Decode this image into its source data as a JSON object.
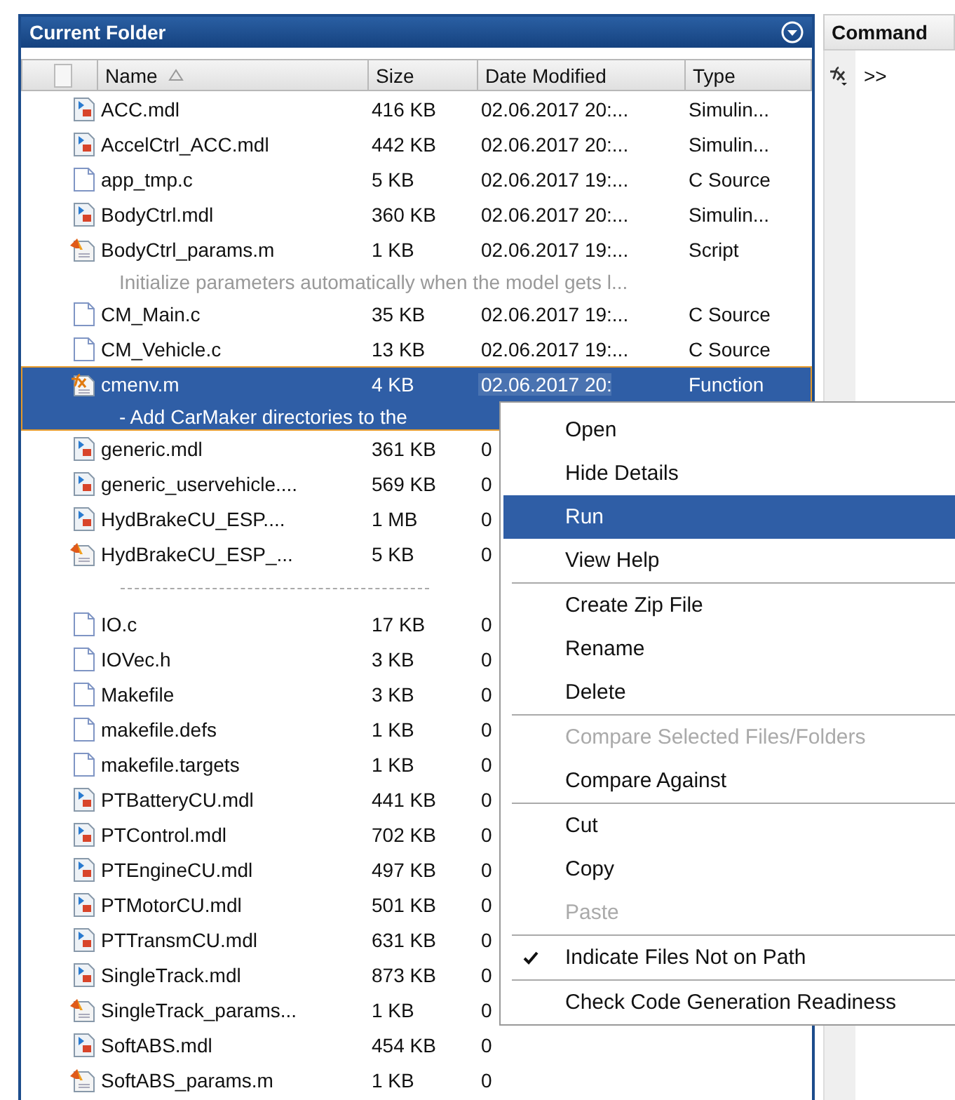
{
  "folder_panel": {
    "title": "Current Folder",
    "columns": [
      {
        "label": "Name",
        "sorted": true
      },
      {
        "label": "Size",
        "sorted": false
      },
      {
        "label": "Date Modified",
        "sorted": false
      },
      {
        "label": "Type",
        "sorted": false
      }
    ],
    "rows": [
      {
        "kind": "model",
        "name": "ACC.mdl",
        "size": "416 KB",
        "date": "02.06.2017 20:...",
        "type": "Simulin...",
        "selected": false
      },
      {
        "kind": "model",
        "name": "AccelCtrl_ACC.mdl",
        "size": "442 KB",
        "date": "02.06.2017 20:...",
        "type": "Simulin...",
        "selected": false
      },
      {
        "kind": "text",
        "name": "app_tmp.c",
        "size": "5 KB",
        "date": "02.06.2017 19:...",
        "type": "C Source",
        "selected": false
      },
      {
        "kind": "model",
        "name": "BodyCtrl.mdl",
        "size": "360 KB",
        "date": "02.06.2017 20:...",
        "type": "Simulin...",
        "selected": false
      },
      {
        "kind": "script",
        "name": "BodyCtrl_params.m",
        "size": "1 KB",
        "date": "02.06.2017 19:...",
        "type": "Script",
        "description": "Initialize parameters automatically when the model gets l...",
        "selected": false
      },
      {
        "kind": "text",
        "name": "CM_Main.c",
        "size": "35 KB",
        "date": "02.06.2017 19:...",
        "type": "C Source",
        "selected": false
      },
      {
        "kind": "text",
        "name": "CM_Vehicle.c",
        "size": "13 KB",
        "date": "02.06.2017 19:...",
        "type": "C Source",
        "selected": false
      },
      {
        "kind": "function",
        "name": "cmenv.m",
        "size": "4 KB",
        "date": "02.06.2017 20:",
        "type": "Function",
        "description": "- Add CarMaker directories to the",
        "selected": true
      },
      {
        "kind": "model",
        "name": "generic.mdl",
        "size": "361 KB",
        "date": "0",
        "selected": false
      },
      {
        "kind": "model",
        "name": "generic_uservehicle....",
        "size": "569 KB",
        "date": "0",
        "selected": false
      },
      {
        "kind": "model",
        "name": "HydBrakeCU_ESP....",
        "size": "1 MB",
        "date": "0",
        "selected": false
      },
      {
        "kind": "script",
        "name": "HydBrakeCU_ESP_...",
        "size": "5 KB",
        "date": "0",
        "selected": false
      },
      {
        "kind": "divider"
      },
      {
        "kind": "text",
        "name": "IO.c",
        "size": "17 KB",
        "date": "0",
        "selected": false
      },
      {
        "kind": "text",
        "name": "IOVec.h",
        "size": "3 KB",
        "date": "0",
        "selected": false
      },
      {
        "kind": "text",
        "name": "Makefile",
        "size": "3 KB",
        "date": "0",
        "selected": false
      },
      {
        "kind": "text",
        "name": "makefile.defs",
        "size": "1 KB",
        "date": "0",
        "selected": false
      },
      {
        "kind": "text",
        "name": "makefile.targets",
        "size": "1 KB",
        "date": "0",
        "selected": false
      },
      {
        "kind": "model",
        "name": "PTBatteryCU.mdl",
        "size": "441 KB",
        "date": "0",
        "selected": false
      },
      {
        "kind": "model",
        "name": "PTControl.mdl",
        "size": "702 KB",
        "date": "0",
        "selected": false
      },
      {
        "kind": "model",
        "name": "PTEngineCU.mdl",
        "size": "497 KB",
        "date": "0",
        "selected": false
      },
      {
        "kind": "model",
        "name": "PTMotorCU.mdl",
        "size": "501 KB",
        "date": "0",
        "selected": false
      },
      {
        "kind": "model",
        "name": "PTTransmCU.mdl",
        "size": "631 KB",
        "date": "0",
        "selected": false
      },
      {
        "kind": "model",
        "name": "SingleTrack.mdl",
        "size": "873 KB",
        "date": "0",
        "selected": false
      },
      {
        "kind": "script",
        "name": "SingleTrack_params...",
        "size": "1 KB",
        "date": "0",
        "selected": false
      },
      {
        "kind": "model",
        "name": "SoftABS.mdl",
        "size": "454 KB",
        "date": "0",
        "selected": false
      },
      {
        "kind": "script",
        "name": "SoftABS_params.m",
        "size": "1 KB",
        "date": "0",
        "selected": false
      }
    ]
  },
  "command_panel": {
    "title": "Command",
    "prompt": ">>"
  },
  "context_menu": [
    {
      "label": "Open",
      "disabled": false,
      "selected": false,
      "checked": false
    },
    {
      "label": "Hide Details",
      "disabled": false,
      "selected": false,
      "checked": false
    },
    {
      "label": "Run",
      "disabled": false,
      "selected": true,
      "checked": false
    },
    {
      "label": "View Help",
      "disabled": false,
      "selected": false,
      "checked": false,
      "separator_after": true
    },
    {
      "label": "Create Zip File",
      "disabled": false,
      "selected": false,
      "checked": false
    },
    {
      "label": "Rename",
      "disabled": false,
      "selected": false,
      "checked": false
    },
    {
      "label": "Delete",
      "disabled": false,
      "selected": false,
      "checked": false,
      "separator_after": true
    },
    {
      "label": "Compare Selected Files/Folders",
      "disabled": true,
      "selected": false,
      "checked": false
    },
    {
      "label": "Compare Against",
      "disabled": false,
      "selected": false,
      "checked": false,
      "separator_after": true
    },
    {
      "label": "Cut",
      "disabled": false,
      "selected": false,
      "checked": false
    },
    {
      "label": "Copy",
      "disabled": false,
      "selected": false,
      "checked": false
    },
    {
      "label": "Paste",
      "disabled": true,
      "selected": false,
      "checked": false,
      "separator_after": true
    },
    {
      "label": "Indicate Files Not on Path",
      "disabled": false,
      "selected": false,
      "checked": true,
      "separator_after": true
    },
    {
      "label": "Check Code Generation Readiness",
      "disabled": false,
      "selected": false,
      "checked": false
    }
  ]
}
